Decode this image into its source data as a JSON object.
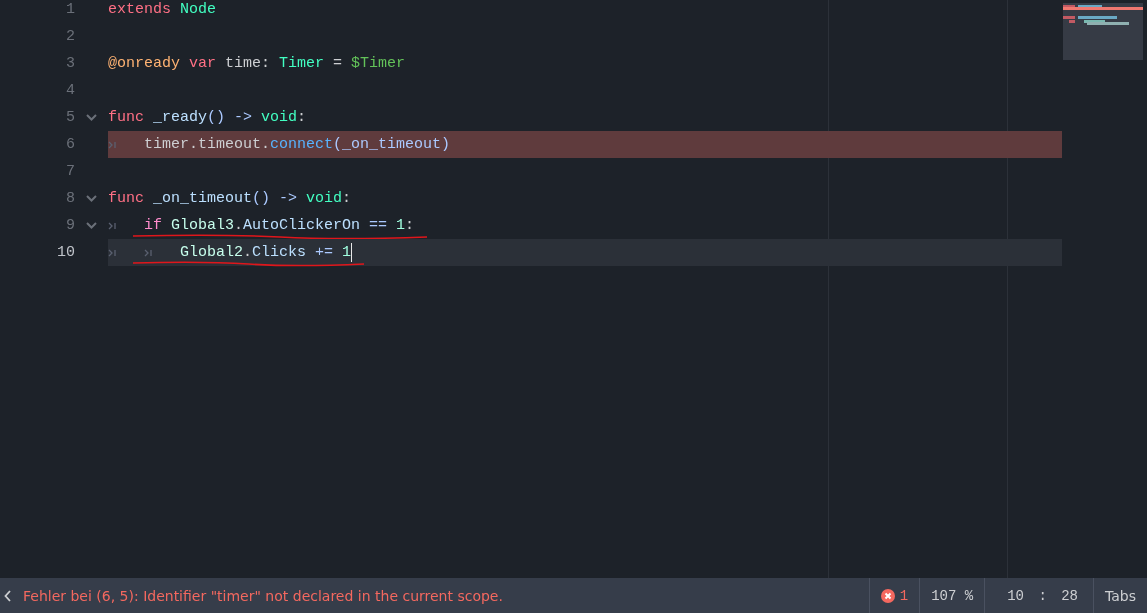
{
  "editor": {
    "lines": [
      {
        "number": "1",
        "foldable": false,
        "error": false,
        "current": false,
        "annotated": false,
        "tokens": [
          {
            "kind": "keyword",
            "text": "extends "
          },
          {
            "kind": "type",
            "text": "Node"
          }
        ]
      },
      {
        "number": "2",
        "foldable": false,
        "error": false,
        "current": false,
        "annotated": false
      },
      {
        "number": "3",
        "foldable": false,
        "error": false,
        "current": false,
        "annotated": false,
        "tokens": [
          {
            "kind": "annotation",
            "text": "@onready "
          },
          {
            "kind": "keyword",
            "text": "var "
          },
          {
            "kind": "plain",
            "text": "time: "
          },
          {
            "kind": "type",
            "text": "Timer"
          },
          {
            "kind": "plain",
            "text": " = "
          },
          {
            "kind": "nodepath",
            "text": "$Timer"
          }
        ]
      },
      {
        "number": "4",
        "foldable": false,
        "error": false,
        "current": false,
        "annotated": false
      },
      {
        "number": "5",
        "foldable": true,
        "error": false,
        "current": false,
        "annotated": false,
        "tokens": [
          {
            "kind": "keyword",
            "text": "func "
          },
          {
            "kind": "member",
            "text": "_ready"
          },
          {
            "kind": "symbol",
            "text": "() -> "
          },
          {
            "kind": "type",
            "text": "void"
          },
          {
            "kind": "plain",
            "text": ":"
          }
        ]
      },
      {
        "number": "6",
        "foldable": false,
        "error": true,
        "current": false,
        "annotated": false,
        "tokens": [
          {
            "kind": "tab"
          },
          {
            "kind": "plain",
            "text": "timer.timeout."
          },
          {
            "kind": "function",
            "text": "connect"
          },
          {
            "kind": "symbol",
            "text": "(_on_timeout)"
          }
        ]
      },
      {
        "number": "7",
        "foldable": false,
        "error": false,
        "current": false,
        "annotated": false
      },
      {
        "number": "8",
        "foldable": true,
        "error": false,
        "current": false,
        "annotated": false,
        "tokens": [
          {
            "kind": "keyword",
            "text": "func "
          },
          {
            "kind": "member",
            "text": "_on_timeout"
          },
          {
            "kind": "symbol",
            "text": "() -> "
          },
          {
            "kind": "type",
            "text": "void"
          },
          {
            "kind": "plain",
            "text": ":"
          }
        ]
      },
      {
        "number": "9",
        "foldable": true,
        "error": false,
        "current": false,
        "annotated": true,
        "tokens": [
          {
            "kind": "tab"
          },
          {
            "kind": "control",
            "text": "if "
          },
          {
            "kind": "usertype",
            "text": "Global3"
          },
          {
            "kind": "plain",
            "text": "."
          },
          {
            "kind": "member",
            "text": "AutoClickerOn"
          },
          {
            "kind": "symbol",
            "text": " == "
          },
          {
            "kind": "number",
            "text": "1"
          },
          {
            "kind": "plain",
            "text": ":"
          }
        ]
      },
      {
        "number": "10",
        "foldable": false,
        "error": false,
        "current": true,
        "annotated": true,
        "tokens": [
          {
            "kind": "tab"
          },
          {
            "kind": "tab"
          },
          {
            "kind": "usertype",
            "text": "Global2"
          },
          {
            "kind": "plain",
            "text": "."
          },
          {
            "kind": "member",
            "text": "Clicks"
          },
          {
            "kind": "symbol",
            "text": " += "
          },
          {
            "kind": "number",
            "text": "1"
          }
        ]
      }
    ]
  },
  "status_bar": {
    "message": "Fehler bei (6, 5): Identifier \"timer\" not declared in the current scope.",
    "error_count": "1",
    "zoom": "107 %",
    "position": "10 : 28",
    "indent_mode": "Tabs"
  }
}
